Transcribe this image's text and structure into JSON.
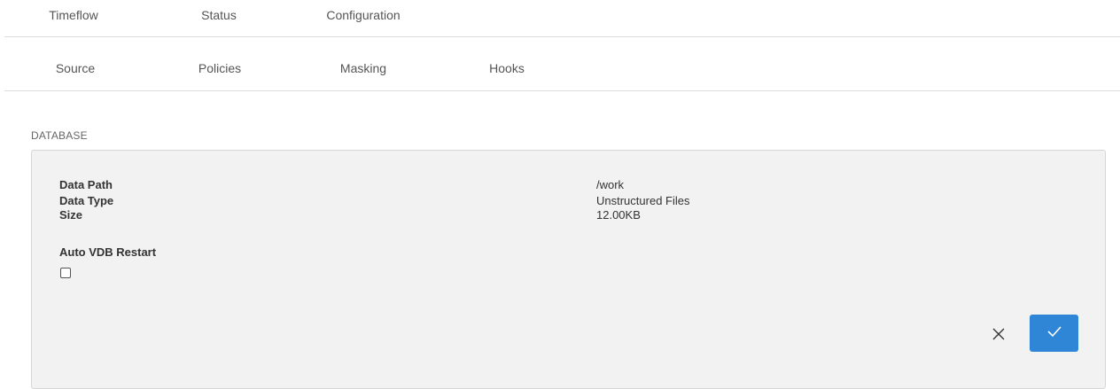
{
  "tabs": {
    "top": [
      {
        "label": "Timeflow"
      },
      {
        "label": "Status"
      },
      {
        "label": "Configuration"
      }
    ],
    "sub": [
      {
        "label": "Source"
      },
      {
        "label": "Policies"
      },
      {
        "label": "Masking"
      },
      {
        "label": "Hooks"
      }
    ]
  },
  "section": {
    "title": "DATABASE"
  },
  "details": [
    {
      "label": "Data Path",
      "value": "/work"
    },
    {
      "label": "Data Type",
      "value": "Unstructured Files"
    },
    {
      "label": "Size",
      "value": "12.00KB"
    }
  ],
  "auto_restart": {
    "label": "Auto VDB Restart",
    "checked": false
  },
  "actions": {
    "cancel_icon": "close-icon",
    "confirm_icon": "checkmark-icon",
    "confirm_color": "#2f86d6"
  }
}
